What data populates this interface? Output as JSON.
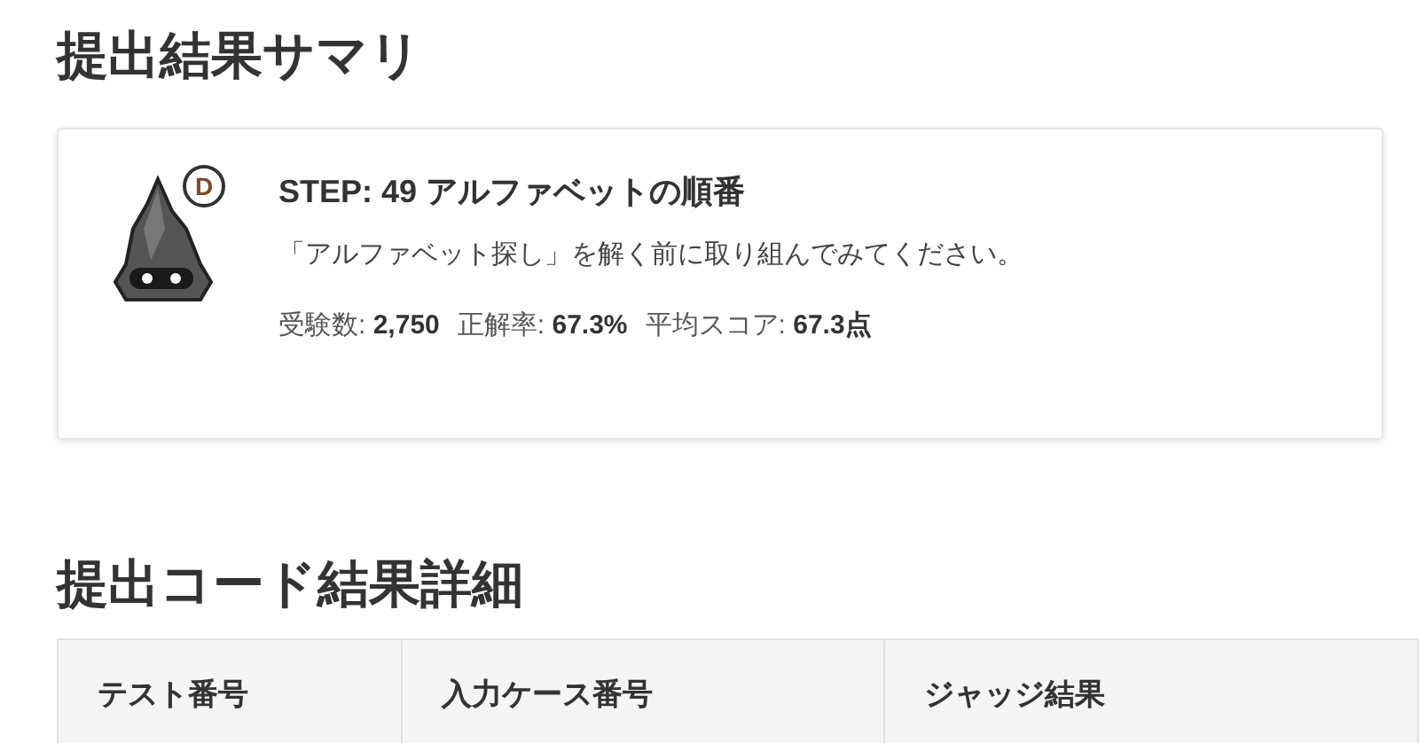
{
  "summary": {
    "heading": "提出結果サマリ",
    "badge": "D",
    "title": "STEP: 49 アルファベットの順番",
    "description": "「アルファベット探し」を解く前に取り組んでみてください。",
    "stats": [
      {
        "label": "受験数:",
        "value": "2,750"
      },
      {
        "label": "正解率:",
        "value": "67.3%"
      },
      {
        "label": "平均スコア:",
        "value": "67.3点"
      }
    ]
  },
  "details": {
    "heading": "提出コード結果詳細",
    "table": {
      "columns": [
        "テスト番号",
        "入力ケース番号",
        "ジャッジ結果"
      ]
    }
  }
}
